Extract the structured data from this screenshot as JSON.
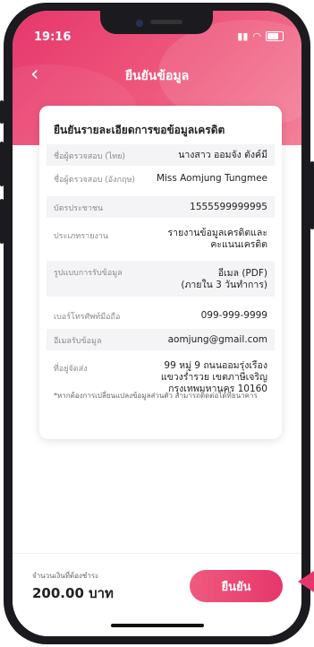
{
  "status_bar": {
    "time": "19:16"
  },
  "header": {
    "title": "ยืนยันข้อมูล"
  },
  "card": {
    "title": "ยืนยันรายละเอียดการขอข้อมูลเครดิต",
    "rows": [
      {
        "label": "ชื่อผู้ตรวจสอบ (ไทย)",
        "value": "นางสาว ออมจัง ตังค์มี"
      },
      {
        "label": "ชื่อผู้ตรวจสอบ (อังกฤษ)",
        "value": "Miss Aomjung Tungmee"
      },
      {
        "label": "บัตรประชาชน",
        "value": "1555599999995"
      },
      {
        "label": "ประเภทรายงาน",
        "value": "รายงานข้อมูลเครดิตและ\nคะแนนเครดิต"
      },
      {
        "label": "รูปแบบการรับข้อมูล",
        "value": "อีเมล (PDF)\n(ภายใน 3 วันทำการ)"
      },
      {
        "label": "เบอร์โทรศัพท์มือถือ",
        "value": "099-999-9999"
      },
      {
        "label": "อีเมลรับข้อมูล",
        "value": "aomjung@gmail.com"
      },
      {
        "label": "ที่อยู่จัดส่ง",
        "value": "99 หมู่ 9 ถนนออมรุ่งเรือง\nแขวงร่ำรวย เขตภาษีเจริญ\nกรุงเทพมหานคร 10160"
      }
    ],
    "note": "*หากต้องการเปลี่ยนแปลงข้อมูลส่วนตัว สามารถติดต่อได้ที่ธนาคาร"
  },
  "footer": {
    "amount_label": "จำนวนเงินที่ต้องชำระ",
    "amount_value": "200.00 บาท",
    "confirm_label": "ยืนยัน"
  },
  "colors": {
    "accent": "#e6376c",
    "accent_light": "#ef5a7e"
  }
}
